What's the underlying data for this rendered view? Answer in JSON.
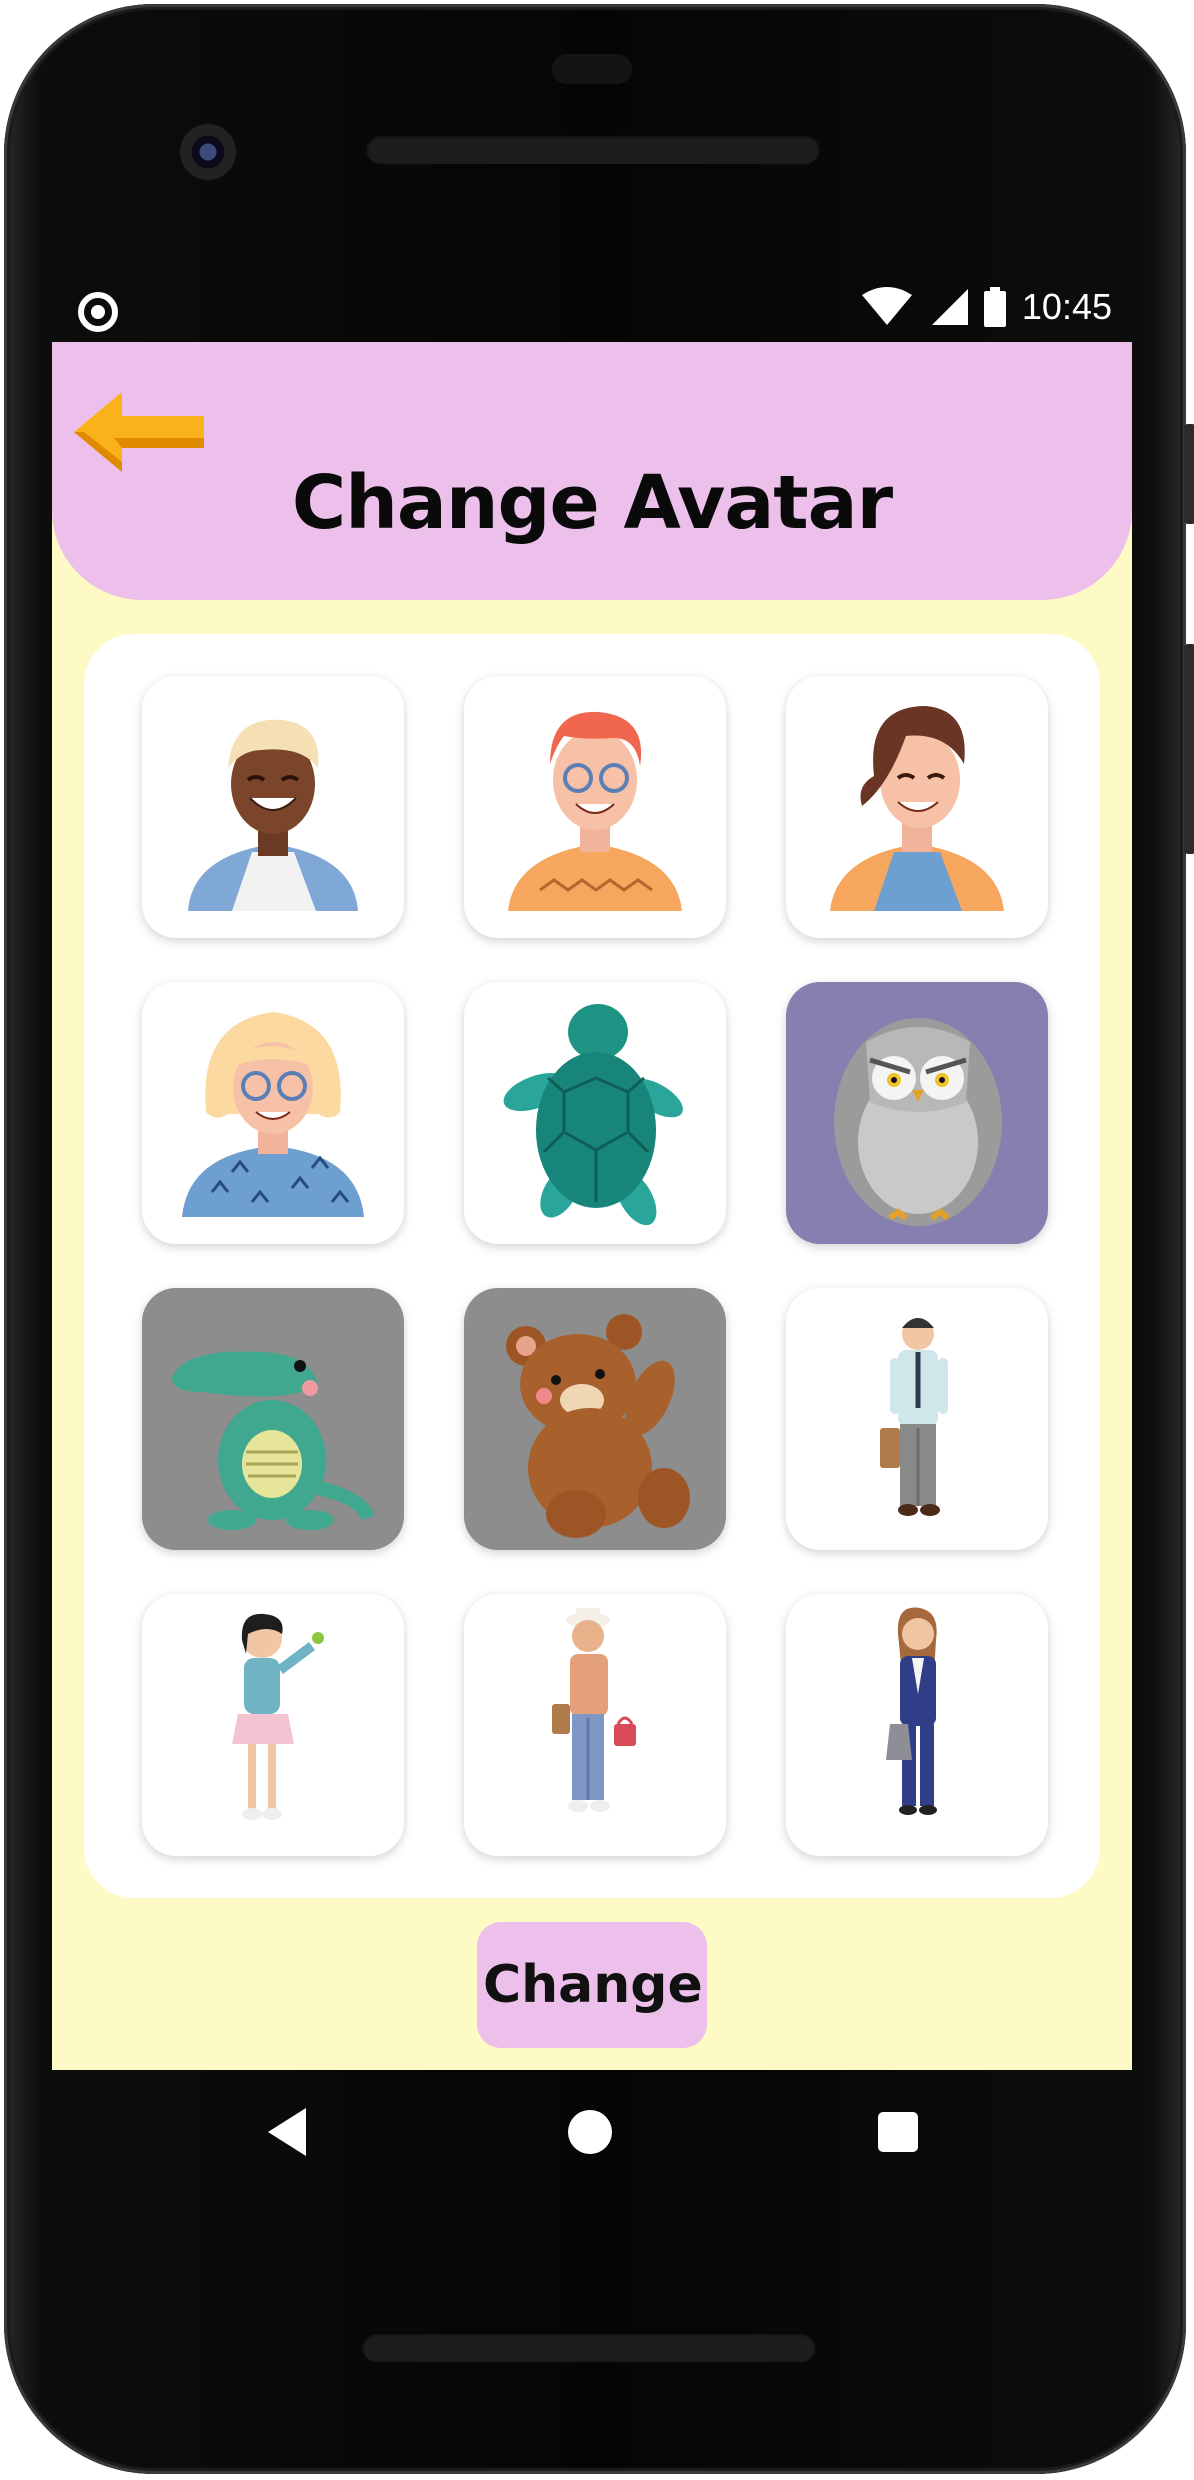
{
  "status_bar": {
    "time": "10:45",
    "icons": [
      "record-icon",
      "wifi-icon",
      "signal-icon",
      "battery-icon"
    ]
  },
  "header": {
    "title": "Change Avatar",
    "back_icon": "back-arrow-icon"
  },
  "avatars": [
    {
      "id": "avatar-1",
      "depicts": "man-with-blond-hair"
    },
    {
      "id": "avatar-2",
      "depicts": "red-haired-man-with-glasses"
    },
    {
      "id": "avatar-3",
      "depicts": "woman-with-brown-hair"
    },
    {
      "id": "avatar-4",
      "depicts": "blonde-woman-with-glasses"
    },
    {
      "id": "avatar-5",
      "depicts": "sea-turtle"
    },
    {
      "id": "avatar-6",
      "depicts": "owl"
    },
    {
      "id": "avatar-7",
      "depicts": "crocodile"
    },
    {
      "id": "avatar-8",
      "depicts": "teddy-bear"
    },
    {
      "id": "avatar-9",
      "depicts": "businessman-with-briefcase"
    },
    {
      "id": "avatar-10",
      "depicts": "girl-with-bird"
    },
    {
      "id": "avatar-11",
      "depicts": "man-with-hat-and-bag"
    },
    {
      "id": "avatar-12",
      "depicts": "businesswoman"
    }
  ],
  "actions": {
    "change_label": "Change"
  },
  "colors": {
    "header_bg": "#ecc0ea",
    "screen_bg": "#fefac6",
    "button_bg": "#ecc0ea",
    "back_arrow": "#f9b21a"
  },
  "nav_bar": {
    "icons": [
      "nav-back-icon",
      "nav-home-icon",
      "nav-recent-icon"
    ]
  }
}
